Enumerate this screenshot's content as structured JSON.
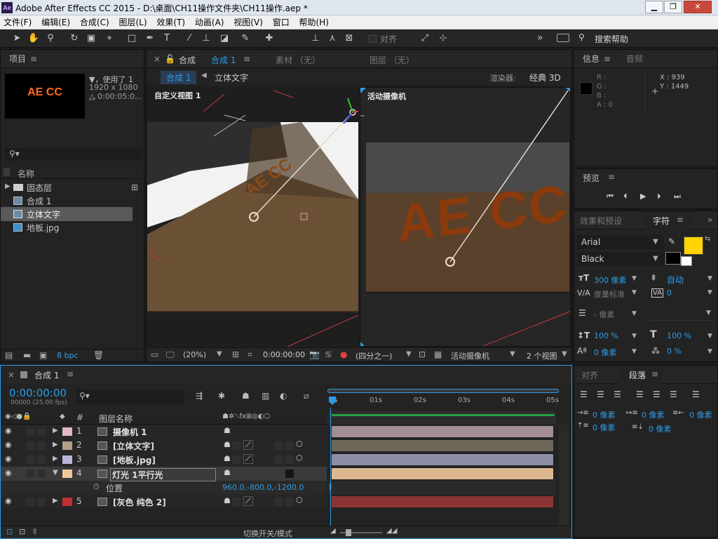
{
  "window": {
    "app_icon": "Ae",
    "title": "Adobe After Effects CC 2015 - D:\\桌面\\CH11操作文件夹\\CH11操作.aep *",
    "min": "▁",
    "max": "❐",
    "close": "✕"
  },
  "menu": [
    "文件(F)",
    "编辑(E)",
    "合成(C)",
    "图层(L)",
    "效果(T)",
    "动画(A)",
    "视图(V)",
    "窗口",
    "帮助(H)"
  ],
  "toolbar": {
    "snap_label": "对齐",
    "search_placeholder": "搜索帮助",
    "more": "»"
  },
  "project": {
    "title": "项目",
    "thumb_text": "AE CC",
    "used": "▼，使用了 1",
    "size": "1920 x 1080 ...",
    "duration": "△ 0:00:05:0...",
    "search_icon": "⚲▾",
    "col_name": "名称",
    "items": [
      {
        "name": "固态层",
        "type": "folder",
        "expander": "▶"
      },
      {
        "name": "合成 1",
        "type": "comp"
      },
      {
        "name": "立体文字",
        "type": "comp",
        "selected": true
      },
      {
        "name": "地板.jpg",
        "type": "image"
      }
    ],
    "bpc": "8 bpc"
  },
  "viewer": {
    "comp_tab": "合成",
    "comp_name": "合成 1",
    "footage_tab": "素材 （无）",
    "layer_tab": "图层 （无）",
    "crumb_comp": "合成 1",
    "crumb_sub": "立体文字",
    "renderer_label": "渲染器:",
    "renderer_value": "经典 3D",
    "left_view_label": "自定义视图 1",
    "right_view_label": "活动摄像机",
    "scene_text": "AE CC",
    "zoom": "(20%)",
    "time": "0:00:00:00",
    "resolution": "(四分之一)",
    "camera": "活动摄像机",
    "views": "2 个视图"
  },
  "info": {
    "tab_info": "信息",
    "tab_audio": "音频",
    "r": "R :",
    "g": "G :",
    "b": "B :",
    "a": "A : 0",
    "x": "X : 939",
    "y": "Y : 1449"
  },
  "preview": {
    "title": "预览"
  },
  "character": {
    "tab_effects": "效果和预设",
    "tab_char": "字符",
    "font": "Arial",
    "style": "Black",
    "fill_color": "#ffd400",
    "size": "300 像素",
    "leading": "自动",
    "kerning": "度量标准",
    "tracking": "0",
    "stroke": "- 像素",
    "vscale": "100 %",
    "hscale": "100 %",
    "baseline": "0 像素",
    "tsume": "0 %"
  },
  "paragraph": {
    "tab_align": "对齐",
    "tab_para": "段落",
    "indent_left": "0 像素",
    "indent_first": "0 像素",
    "indent_right": "0 像素",
    "space_before": "0 像素",
    "space_after": "0 像素"
  },
  "timeline": {
    "tab": "合成 1",
    "timecode": "0:00:00:00",
    "frames": "00000 (25.00 fps)",
    "col_num": "#",
    "col_name": "图层名称",
    "ruler": [
      "0s",
      "01s",
      "02s",
      "03s",
      "04s",
      "05s"
    ],
    "layers": [
      {
        "num": "1",
        "name": "摄像机 1",
        "color": "#e3b7c3",
        "track": "#a48c95",
        "expander": "▶"
      },
      {
        "num": "2",
        "name": "[立体文字]",
        "color": "#b29f86",
        "track": "#6e6758",
        "expander": "▶"
      },
      {
        "num": "3",
        "name": "[地板.jpg]",
        "color": "#b8b7d9",
        "track": "#8d8ea4",
        "expander": "▶"
      },
      {
        "num": "4",
        "name": "灯光 1平行光",
        "color": "#f1c89a",
        "track": "#dcb790",
        "expander": "▼"
      },
      {
        "num": "5",
        "name": "[灰色 纯色 2]",
        "color": "#c03030",
        "track": "#8c3434",
        "expander": "▶"
      }
    ],
    "prop_name": "位置",
    "prop_value": "960.0,-800.0,-1200.0",
    "switch_label": "切换开关/模式"
  },
  "colors": {
    "accent": "#2f9be6",
    "panel": "#232323",
    "selection": "#5a5a5a"
  }
}
